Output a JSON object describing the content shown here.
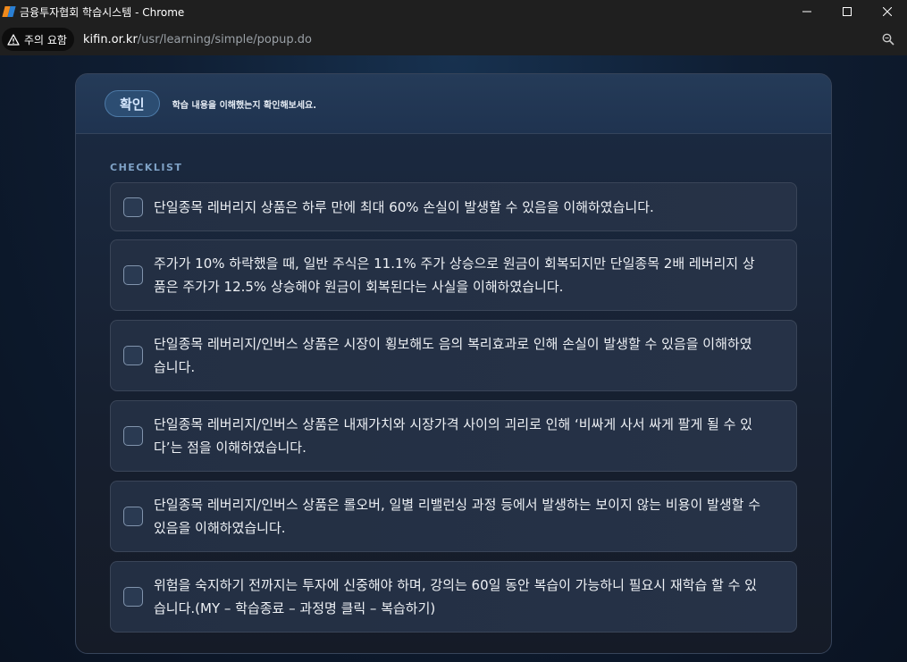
{
  "window": {
    "title": "금융투자협회 학습시스템 - Chrome"
  },
  "addressbar": {
    "warning_label": "주의 요함",
    "url_host": "kifin.or.kr",
    "url_path": "/usr/learning/simple/popup.do"
  },
  "header": {
    "confirm_label": "확인",
    "note": "학습 내용을 이해했는지 확인해보세요."
  },
  "checklist": {
    "label": "CHECKLIST",
    "items": [
      {
        "text": "단일종목 레버리지 상품은 하루 만에 최대 60% 손실이 발생할 수 있음을 이해하였습니다.",
        "checked": false
      },
      {
        "text": "주가가 10% 하락했을 때, 일반 주식은 11.1% 주가 상승으로 원금이 회복되지만 단일종목 2배 레버리지 상품은 주가가 12.5% 상승해야 원금이 회복된다는 사실을 이해하였습니다.",
        "checked": false
      },
      {
        "text": "단일종목 레버리지/인버스 상품은 시장이 횡보해도 음의 복리효과로 인해 손실이 발생할 수 있음을 이해하였습니다.",
        "checked": false
      },
      {
        "text": "단일종목 레버리지/인버스 상품은 내재가치와 시장가격 사이의 괴리로 인해 ‘비싸게 사서 싸게 팔게 될 수 있다’는 점을 이해하였습니다.",
        "checked": false
      },
      {
        "text": "단일종목 레버리지/인버스 상품은 롤오버, 일별 리밸런싱 과정 등에서 발생하는 보이지 않는 비용이 발생할 수 있음을 이해하였습니다.",
        "checked": false
      },
      {
        "text": "위험을 숙지하기 전까지는 투자에 신중해야 하며, 강의는 60일 동안 복습이 가능하니 필요시 재학습 할 수 있습니다.(MY – 학습종료 – 과정명 클릭 – 복습하기)",
        "checked": false
      }
    ]
  }
}
